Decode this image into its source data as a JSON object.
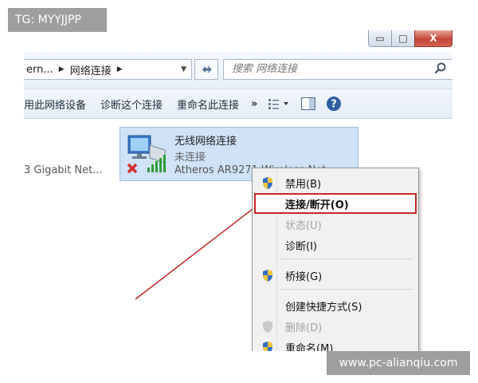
{
  "window": {
    "minimize": "▭",
    "maximize": "□",
    "close": "X"
  },
  "address_bar": {
    "crumbs": [
      "ern...",
      "网络连接"
    ],
    "refresh_icon": "refresh-icon",
    "search_placeholder": "搜索 网络连接",
    "search_icon": "search-icon"
  },
  "command_bar": {
    "items": [
      "用此网络设备",
      "诊断这个连接",
      "重命名此连接"
    ],
    "more": "»"
  },
  "adapters": {
    "left_partial": "3 Gigabit Net...",
    "tile": {
      "name": "无线网络连接",
      "status": "未连接",
      "device": "Atheros AR9271 Wireless Net..."
    }
  },
  "context_menu": {
    "items": [
      {
        "label": "禁用(B)",
        "state": "normal",
        "shield": true
      },
      {
        "label": "连接/断开(O)",
        "state": "highlighted",
        "shield": false
      },
      {
        "label": "状态(U)",
        "state": "disabled",
        "shield": false
      },
      {
        "label": "诊断(I)",
        "state": "normal",
        "shield": false
      },
      {
        "label": "桥接(G)",
        "state": "normal",
        "shield": true
      },
      {
        "label": "创建快捷方式(S)",
        "state": "normal",
        "shield": false
      },
      {
        "label": "删除(D)",
        "state": "disabled",
        "shield": true
      },
      {
        "label": "重命名(M)",
        "state": "normal",
        "shield": true
      }
    ]
  },
  "watermarks": {
    "top_left": "TG: MYYJJPP",
    "bottom_right": "www.pc-alianqiu.com"
  },
  "colors": {
    "highlight_outline": "#c62828",
    "arrow": "#c62828",
    "tile_bg": "#cfe2f6"
  }
}
